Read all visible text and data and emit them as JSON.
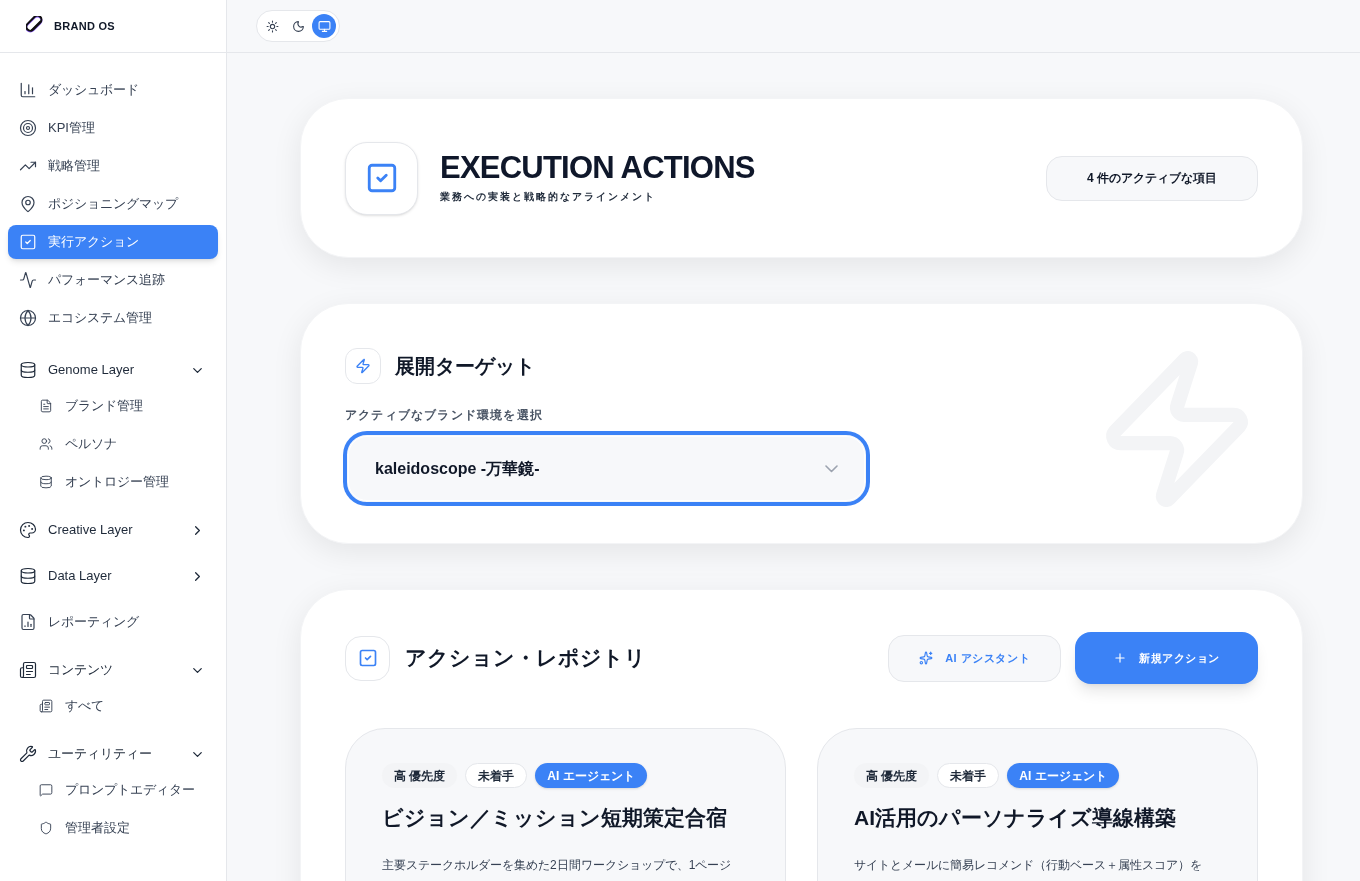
{
  "brand": {
    "name": "BRAND OS"
  },
  "theme_toggle": [
    {
      "selected": false
    },
    {
      "selected": false
    },
    {
      "selected": true
    }
  ],
  "sidebar": {
    "items": [
      {
        "kind": "link",
        "label": "ダッシュボード",
        "selected": false
      },
      {
        "kind": "link",
        "label": "KPI管理",
        "selected": false
      },
      {
        "kind": "link",
        "label": "戦略管理",
        "selected": false
      },
      {
        "kind": "link",
        "label": "ポジショニングマップ",
        "selected": false
      },
      {
        "kind": "link",
        "label": "実行アクション",
        "selected": true
      },
      {
        "kind": "link",
        "label": "パフォーマンス追跡",
        "selected": false
      },
      {
        "kind": "link",
        "label": "エコシステム管理",
        "selected": false
      },
      {
        "kind": "group",
        "label": "Genome Layer",
        "expanded": true,
        "children": [
          {
            "label": "ブランド管理"
          },
          {
            "label": "ペルソナ"
          },
          {
            "label": "オントロジー管理"
          }
        ]
      },
      {
        "kind": "group",
        "label": "Creative Layer",
        "expanded": false
      },
      {
        "kind": "group",
        "label": "Data Layer",
        "expanded": false
      },
      {
        "kind": "link",
        "label": "レポーティング",
        "selected": false
      },
      {
        "kind": "group",
        "label": "コンテンツ",
        "expanded": true,
        "children": [
          {
            "label": "すべて"
          }
        ]
      },
      {
        "kind": "group",
        "label": "ユーティリティー",
        "expanded": true,
        "children": [
          {
            "label": "プロンプトエディター"
          },
          {
            "label": "管理者設定"
          }
        ]
      }
    ]
  },
  "header": {
    "title": "EXECUTION ACTIONS",
    "subtitle": "業務への実装と戦略的なアラインメント",
    "count_badge": "4 件のアクティブな項目"
  },
  "target": {
    "title": "展開ターゲット",
    "select_label": "アクティブなブランド環境を選択",
    "select_value": "kaleidoscope -万華鏡-"
  },
  "repository": {
    "title": "アクション・レポジトリ",
    "buttons": [
      {
        "kind": "secondary",
        "label": "AI アシスタント"
      },
      {
        "kind": "primary",
        "label": "新規アクション"
      }
    ],
    "actions": [
      {
        "tags": [
          {
            "kind": "plain",
            "label": "高 優先度"
          },
          {
            "kind": "outline",
            "label": "未着手"
          },
          {
            "kind": "accent",
            "label": "AI エージェント"
          }
        ],
        "title": "ビジョン／ミッション短期策定合宿",
        "description": "主要ステークホルダーを集めた2日間ワークショップで、1ページ"
      },
      {
        "tags": [
          {
            "kind": "plain",
            "label": "高 優先度"
          },
          {
            "kind": "outline",
            "label": "未着手"
          },
          {
            "kind": "accent",
            "label": "AI エージェント"
          }
        ],
        "title": "AI活用のパーソナライズ導線構築",
        "description": "サイトとメールに簡易レコメンド（行動ベース＋属性スコア）を"
      }
    ]
  }
}
